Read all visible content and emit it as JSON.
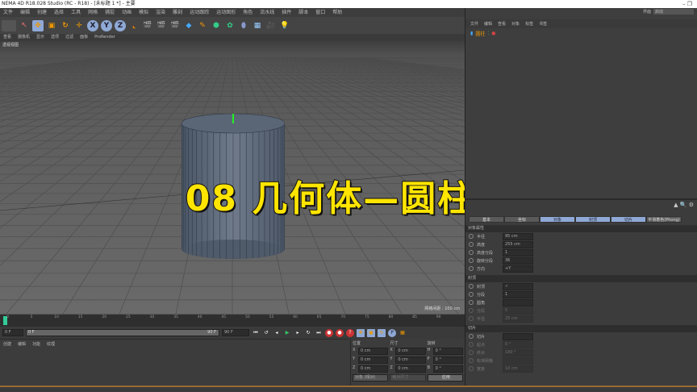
{
  "window": {
    "title": "NEMA 4D R18.028 Studio (RC - R18) - [未标题 1 *] - 主要",
    "controls": "–  ❐"
  },
  "menu": [
    "文件",
    "编辑",
    "创建",
    "选择",
    "工具",
    "网格",
    "捕捉",
    "动画",
    "模拟",
    "渲染",
    "雕刻",
    "运动跟踪",
    "运动图形",
    "角色",
    "流水线",
    "插件",
    "脚本",
    "窗口",
    "帮助"
  ],
  "toolbar": {
    "axes": [
      "X",
      "Y",
      "Z"
    ]
  },
  "viewport": {
    "menu": [
      "查看",
      "摄像机",
      "显示",
      "选项",
      "过滤",
      "面板",
      "ProRender"
    ],
    "title": "透视视图",
    "grid_spacing": "网格间距 : 100 cm"
  },
  "overlay_title": "08 几何体—圆柱体",
  "timeline": {
    "ticks": [
      "0",
      "5",
      "10",
      "15",
      "20",
      "25",
      "30",
      "35",
      "40",
      "45",
      "50",
      "55",
      "60",
      "65",
      "70",
      "75",
      "80",
      "85",
      "90"
    ],
    "end_frame": "0 F",
    "start": "0 F",
    "current": "0 F",
    "range_end": "90 F",
    "max": "90 F"
  },
  "material": {
    "menu": [
      "创建",
      "编辑",
      "功能",
      "纹理"
    ]
  },
  "coords": {
    "headers": [
      "位置",
      "尺寸",
      "旋转"
    ],
    "rows": [
      [
        "X",
        "0 cm",
        "X",
        "0 cm",
        "H",
        "0 °"
      ],
      [
        "Y",
        "0 cm",
        "Y",
        "0 cm",
        "P",
        "0 °"
      ],
      [
        "Z",
        "0 cm",
        "Z",
        "0 cm",
        "B",
        "0 °"
      ]
    ],
    "mode": "对象 (相对)",
    "size_mode": "绝对尺寸",
    "apply": "应用"
  },
  "object_manager": {
    "layout_label": "界面",
    "layout_value": "启动",
    "menu": [
      "文件",
      "编辑",
      "查看",
      "对象",
      "标签",
      "书签"
    ],
    "object": "圆柱"
  },
  "attributes": {
    "tabs": [
      "基本",
      "坐标",
      "对象",
      "封顶",
      "切片",
      "平滑着色(Phong)"
    ],
    "active_tabs": [
      2,
      3,
      4
    ],
    "object_section": "对象属性",
    "props": [
      {
        "label": "半径",
        "value": "95 cm"
      },
      {
        "label": "高度",
        "value": "255 cm"
      },
      {
        "label": "高度分段",
        "value": "1"
      },
      {
        "label": "旋转分段",
        "value": "36"
      },
      {
        "label": "方向",
        "value": "+Y"
      }
    ],
    "caps_section": "封顶",
    "caps": [
      {
        "label": "封顶",
        "value": "✓"
      },
      {
        "label": "分段",
        "value": "1"
      },
      {
        "label": "圆角",
        "value": ""
      },
      {
        "label": "分段",
        "value": "5"
      },
      {
        "label": "半径",
        "value": "25 cm"
      }
    ],
    "slice_section": "切片",
    "slice": [
      {
        "label": "切片",
        "value": ""
      },
      {
        "label": "起点",
        "value": "0 °"
      },
      {
        "label": "终点",
        "value": "180 °"
      },
      {
        "label": "标准网格",
        "value": ""
      },
      {
        "label": "宽度",
        "value": "10 cm"
      }
    ]
  },
  "colors": {
    "accent": "#8fa9d6",
    "overlay": "#ffe500",
    "panel": "#3c3c3c"
  }
}
